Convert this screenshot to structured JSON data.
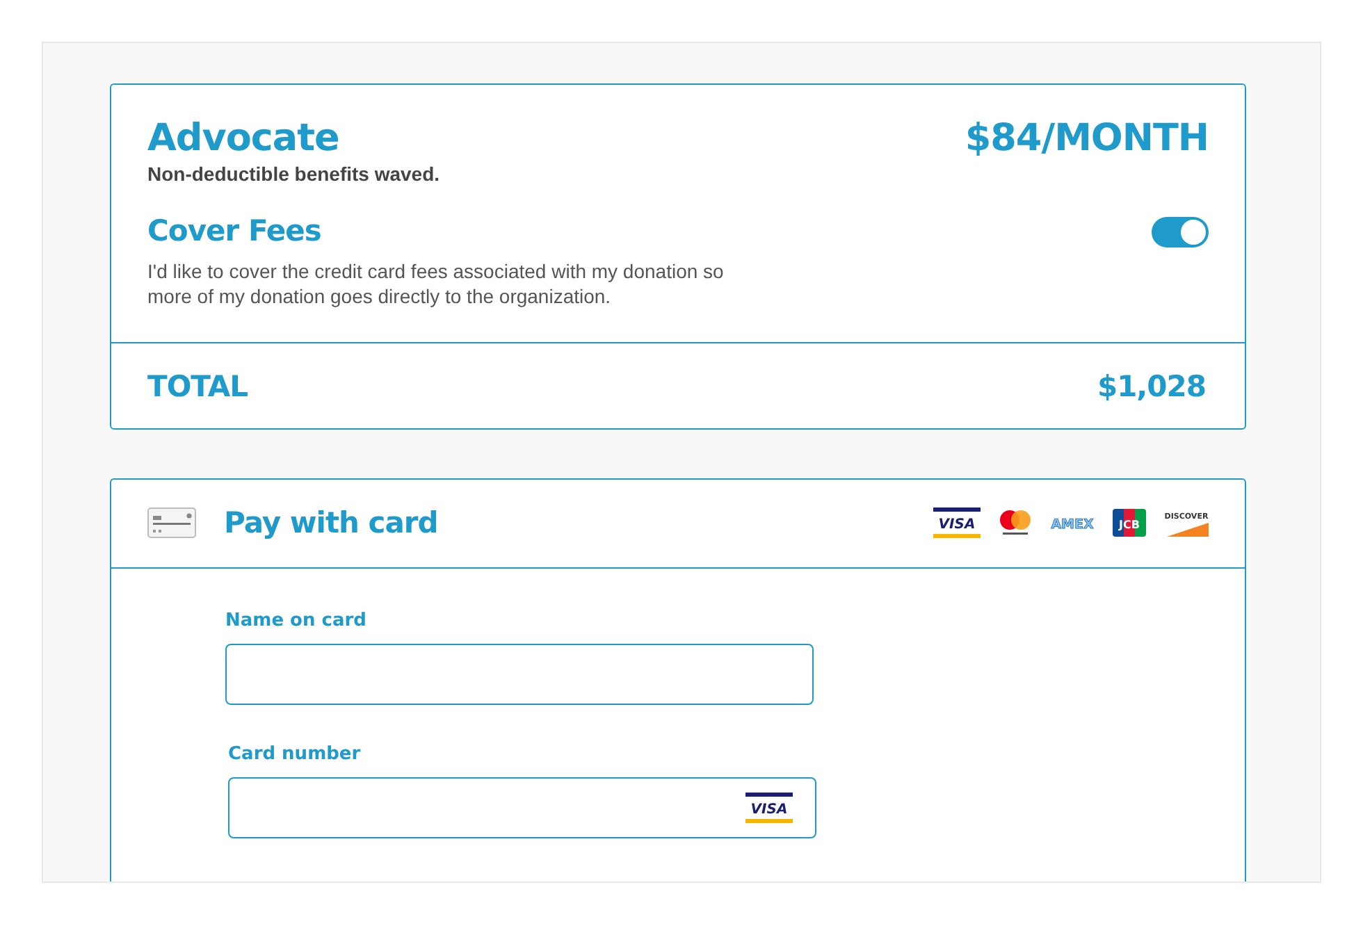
{
  "plan": {
    "name": "Advocate",
    "note": "Non-deductible benefits waved.",
    "price": "$84/MONTH"
  },
  "cover_fees": {
    "title": "Cover Fees",
    "description": "I'd like to cover the credit card fees associated with my donation so more of my donation goes directly to the organization.",
    "on": true
  },
  "total": {
    "label": "TOTAL",
    "amount": "$1,028"
  },
  "payment": {
    "title": "Pay with card",
    "card_brands": [
      {
        "kind": "visa",
        "label": "VISA"
      },
      {
        "kind": "mastercard"
      },
      {
        "kind": "amex",
        "label": "AMEX"
      },
      {
        "kind": "jcb",
        "label": "JCB"
      },
      {
        "kind": "discover",
        "label": "DISCOVER"
      }
    ],
    "fields": [
      {
        "label": "Name on card"
      },
      {
        "label": "Card number",
        "brand": {
          "kind": "visa",
          "label": "VISA"
        }
      }
    ]
  }
}
